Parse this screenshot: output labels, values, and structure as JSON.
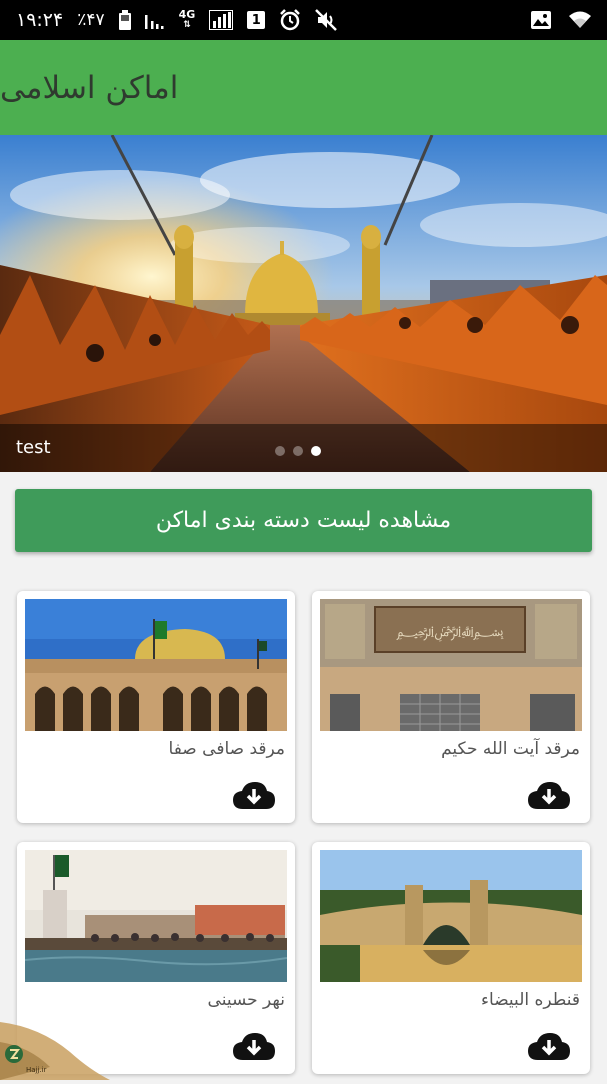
{
  "status_bar": {
    "time": "۱۹:۲۴",
    "battery_percent": "٪۴۷",
    "network_type": "4G",
    "sim_slot": "1",
    "icons": [
      "battery-icon",
      "signal-icon",
      "network-4g-icon",
      "sim-icon",
      "alarm-icon",
      "mute-icon",
      "gallery-icon",
      "wifi-icon"
    ]
  },
  "app_bar": {
    "title": "اماکن اسلامی",
    "color": "#4caf50"
  },
  "slider": {
    "caption": "test",
    "slide_count": 3,
    "active_slide": 3
  },
  "category_button": {
    "label": "مشاهده لیست دسته بندی اماکن",
    "color": "#3f9b5a"
  },
  "places": [
    {
      "title": "مرقد آیت الله حکیم",
      "icon": "download-icon"
    },
    {
      "title": "مرقد صافی صفا",
      "icon": "download-icon"
    },
    {
      "title": "قنطره البیضاء",
      "icon": "download-icon"
    },
    {
      "title": "نهر حسینی",
      "icon": "download-icon"
    }
  ],
  "watermark": {
    "text": "Hajj.ir"
  }
}
